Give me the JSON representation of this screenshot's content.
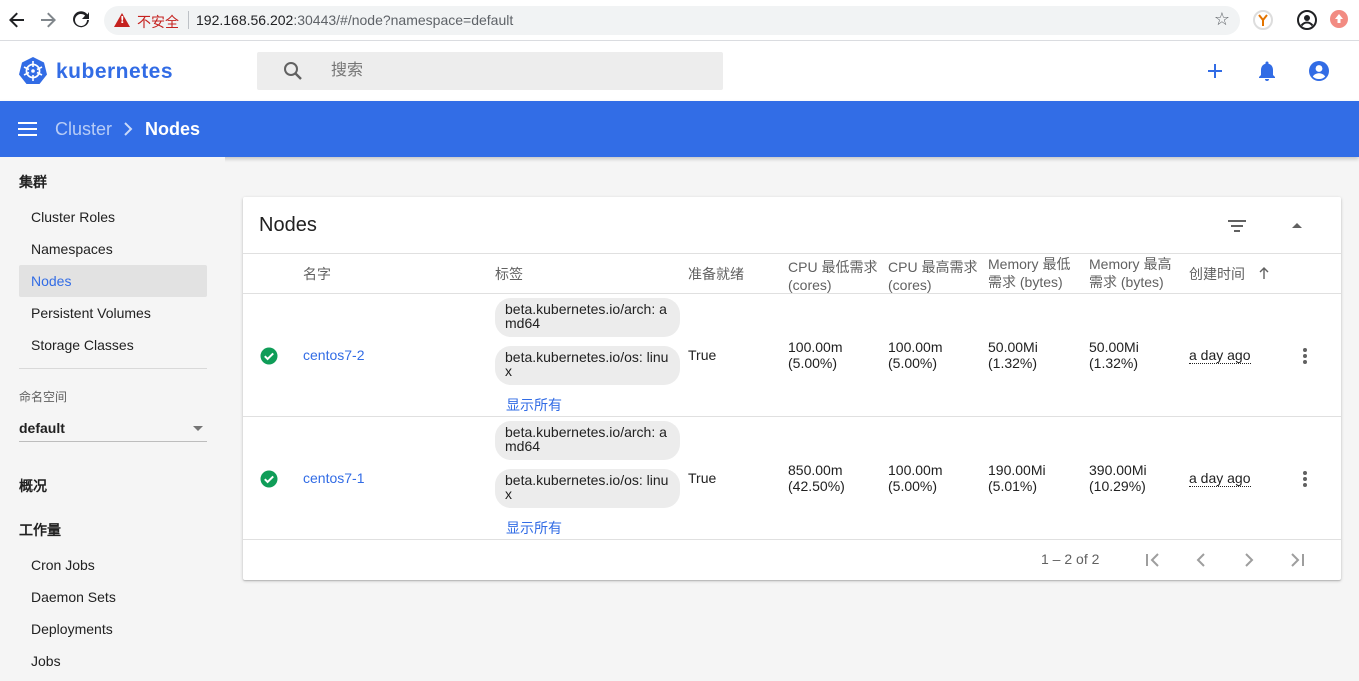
{
  "browser": {
    "insecure_label": "不安全",
    "url_host": "192.168.56.202",
    "url_rest": ":30443/#/node?namespace=default"
  },
  "header": {
    "logo_text": "kubernetes",
    "search_placeholder": "搜索"
  },
  "toolbar": {
    "breadcrumb_parent": "Cluster",
    "breadcrumb_current": "Nodes"
  },
  "sidebar": {
    "cluster_section": "集群",
    "cluster_items": [
      "Cluster Roles",
      "Namespaces",
      "Nodes",
      "Persistent Volumes",
      "Storage Classes"
    ],
    "active_item": "Nodes",
    "namespace_label": "命名空间",
    "namespace_value": "default",
    "overview_section": "概况",
    "workloads_section": "工作量",
    "workload_items": [
      "Cron Jobs",
      "Daemon Sets",
      "Deployments",
      "Jobs"
    ]
  },
  "card": {
    "title": "Nodes",
    "columns": {
      "name": "名字",
      "labels": "标签",
      "ready": "准备就绪",
      "cpu_requests": "CPU 最低需求 (cores)",
      "cpu_limits": "CPU 最高需求 (cores)",
      "mem_requests": "Memory 最低需求 (bytes)",
      "mem_limits": "Memory 最高需求 (bytes)",
      "created": "创建时间"
    },
    "rows": [
      {
        "name": "centos7-2",
        "labels": [
          "beta.kubernetes.io/arch: amd64",
          "beta.kubernetes.io/os: linux"
        ],
        "show_all": "显示所有",
        "ready": "True",
        "cpu_req": "100.00m",
        "cpu_req_pct": "(5.00%)",
        "cpu_lim": "100.00m",
        "cpu_lim_pct": "(5.00%)",
        "mem_req": "50.00Mi",
        "mem_req_pct": "(1.32%)",
        "mem_lim": "50.00Mi",
        "mem_lim_pct": "(1.32%)",
        "age": "a day ago"
      },
      {
        "name": "centos7-1",
        "labels": [
          "beta.kubernetes.io/arch: amd64",
          "beta.kubernetes.io/os: linux"
        ],
        "show_all": "显示所有",
        "ready": "True",
        "cpu_req": "850.00m",
        "cpu_req_pct": "(42.50%)",
        "cpu_lim": "100.00m",
        "cpu_lim_pct": "(5.00%)",
        "mem_req": "190.00Mi",
        "mem_req_pct": "(5.01%)",
        "mem_lim": "390.00Mi",
        "mem_lim_pct": "(10.29%)",
        "age": "a day ago"
      }
    ],
    "pagination": "1 – 2 of 2"
  },
  "colors": {
    "brand": "#326ce5",
    "ready_green": "#0f9d58"
  }
}
